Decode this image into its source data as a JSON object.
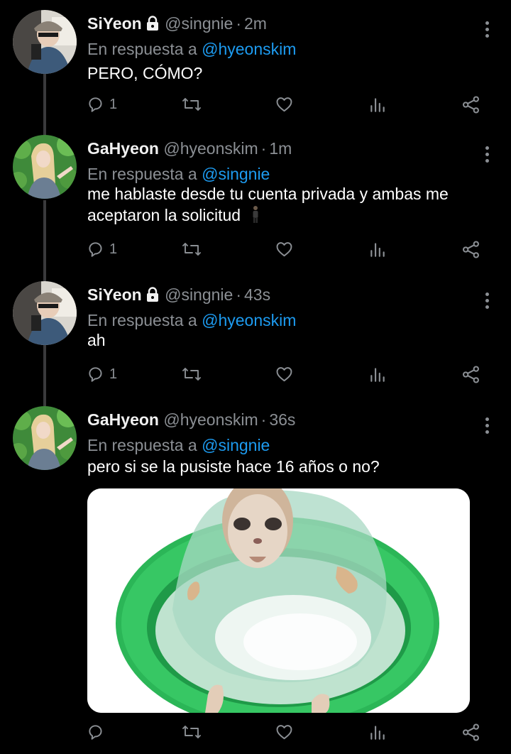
{
  "reply_prefix": "En respuesta a",
  "tweets": [
    {
      "name": "SiYeon",
      "protected": true,
      "handle": "@singnie",
      "time": "2m",
      "reply_to": "@hyeonskim",
      "text_lines": [
        "PERO, CÓMO?"
      ],
      "reply_count": "1",
      "avatar": "avatar-siyeon"
    },
    {
      "name": "GaHyeon",
      "protected": false,
      "handle": "@hyeonskim",
      "time": "1m",
      "reply_to": "@singnie",
      "text_lines": [
        "me hablaste desde tu cuenta privada y ambas me",
        "aceptaron la solicitud"
      ],
      "emoji": "person-standing-emoji",
      "reply_count": "1",
      "avatar": "avatar-gahyeon"
    },
    {
      "name": "SiYeon",
      "protected": true,
      "handle": "@singnie",
      "time": "43s",
      "reply_to": "@hyeonskim",
      "text_lines": [
        "ah"
      ],
      "reply_count": "1",
      "avatar": "avatar-siyeon"
    },
    {
      "name": "GaHyeon",
      "protected": false,
      "handle": "@hyeonskim",
      "time": "36s",
      "reply_to": "@singnie",
      "text_lines": [
        "pero si se la pusiste hace 16 años o no?"
      ],
      "reply_count": "",
      "avatar": "avatar-gahyeon",
      "media": "cat-meme-image"
    }
  ],
  "icons": {
    "reply": "reply-icon",
    "retweet": "retweet-icon",
    "like": "like-icon",
    "analytics": "analytics-icon",
    "share": "share-icon",
    "more": "more-options-icon",
    "lock": "lock-icon"
  },
  "colors": {
    "background": "#000000",
    "accent": "#1d9bf0",
    "muted": "#8b8f94",
    "thread_line": "#3a3a3c"
  }
}
